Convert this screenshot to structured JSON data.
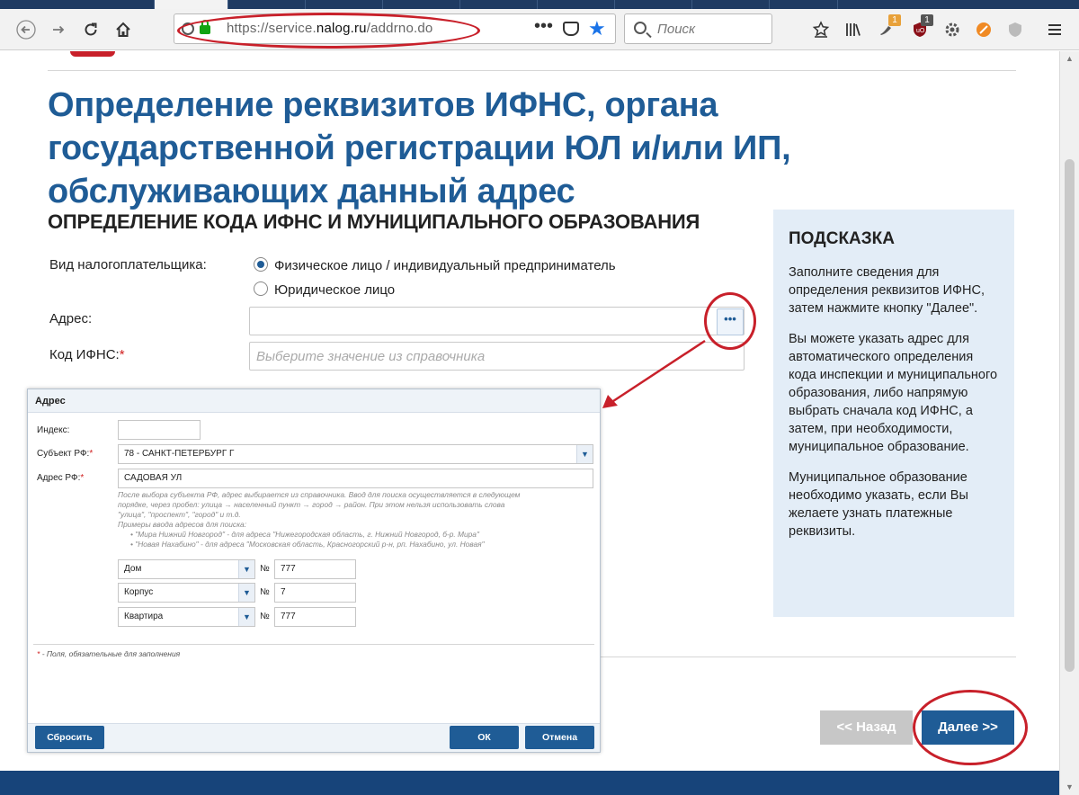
{
  "browser": {
    "url_prefix": "https://service.",
    "url_domain": "nalog.ru",
    "url_path": "/addrno.do",
    "url_menu": "•••",
    "search_placeholder": "Поиск",
    "badge_count_1": "1",
    "badge_count_2": "1",
    "badge_color": "#e8a13a",
    "badge_color_2": "#c8202a"
  },
  "page": {
    "title": "Определение реквизитов ИФНС, органа государственной регистрации ЮЛ и/или ИП, обслуживающих данный адрес",
    "section_title": "ОПРЕДЕЛЕНИЕ КОДА ИФНС И МУНИЦИПАЛЬНОГО ОБРАЗОВАНИЯ",
    "taxpayer_label": "Вид налогоплательщика:",
    "radio_individual": "Физическое лицо / индивидуальный предприниматель",
    "radio_legal": "Юридическое лицо",
    "address_label": "Адрес:",
    "address_button": "•••",
    "ifns_label": "Код ИФНС:",
    "required_mark": "*",
    "ifns_placeholder": "Выберите значение из справочника",
    "back_button": "<< Назад",
    "next_button": "Далее >>",
    "brand_color": "#1f5c96"
  },
  "hint": {
    "title": "ПОДСКАЗКА",
    "p1": "Заполните сведения для определения реквизитов ИФНС, затем нажмите кнопку \"Далее\".",
    "p2": "Вы можете указать адрес для автоматического определения кода инспекции и муниципального образования, либо напрямую выбрать сначала код ИФНС, а затем, при необходимости, муниципальное образование.",
    "p3": "Муниципальное образование необходимо указать, если Вы желаете узнать платежные реквизиты."
  },
  "modal": {
    "title": "Адрес",
    "index_label": "Индекс:",
    "subject_label": "Субъект РФ:",
    "subject_value": "78 - САНКТ-ПЕТЕРБУРГ Г",
    "address_label": "Адрес РФ:",
    "address_value": "САДОВАЯ УЛ",
    "note_line1": "После выбора субъекта РФ, адрес выбирается из справочника. Ввод для поиска осуществляется в следующем",
    "note_line2": "порядке, через пробел: улица → населенный пункт → город → район. При этом нельзя использовать слова",
    "note_line3": "\"улица\", \"проспект\", \"город\" и т.д.",
    "note_line4": "Примеры ввода адресов для поиска:",
    "note_line5": "• \"Мира Нижний Новгород\" - для адреса \"Нижегородская область, г. Нижний Новгород, б-р. Мира\"",
    "note_line6": "• \"Новая Нахабино\" - для адреса \"Московская область, Красногорский р-н, рп. Нахабино, ул. Новая\"",
    "house_type": "Дом",
    "house_value": "777",
    "korpus_type": "Корпус",
    "korpus_value": "7",
    "flat_type": "Квартира",
    "flat_value": "777",
    "number_sign": "№",
    "required_note": "- Поля, обязательные для заполнения",
    "reset_button": "Сбросить",
    "ok_button": "ОК",
    "cancel_button": "Отмена"
  },
  "annotation_color": "#c8202a"
}
